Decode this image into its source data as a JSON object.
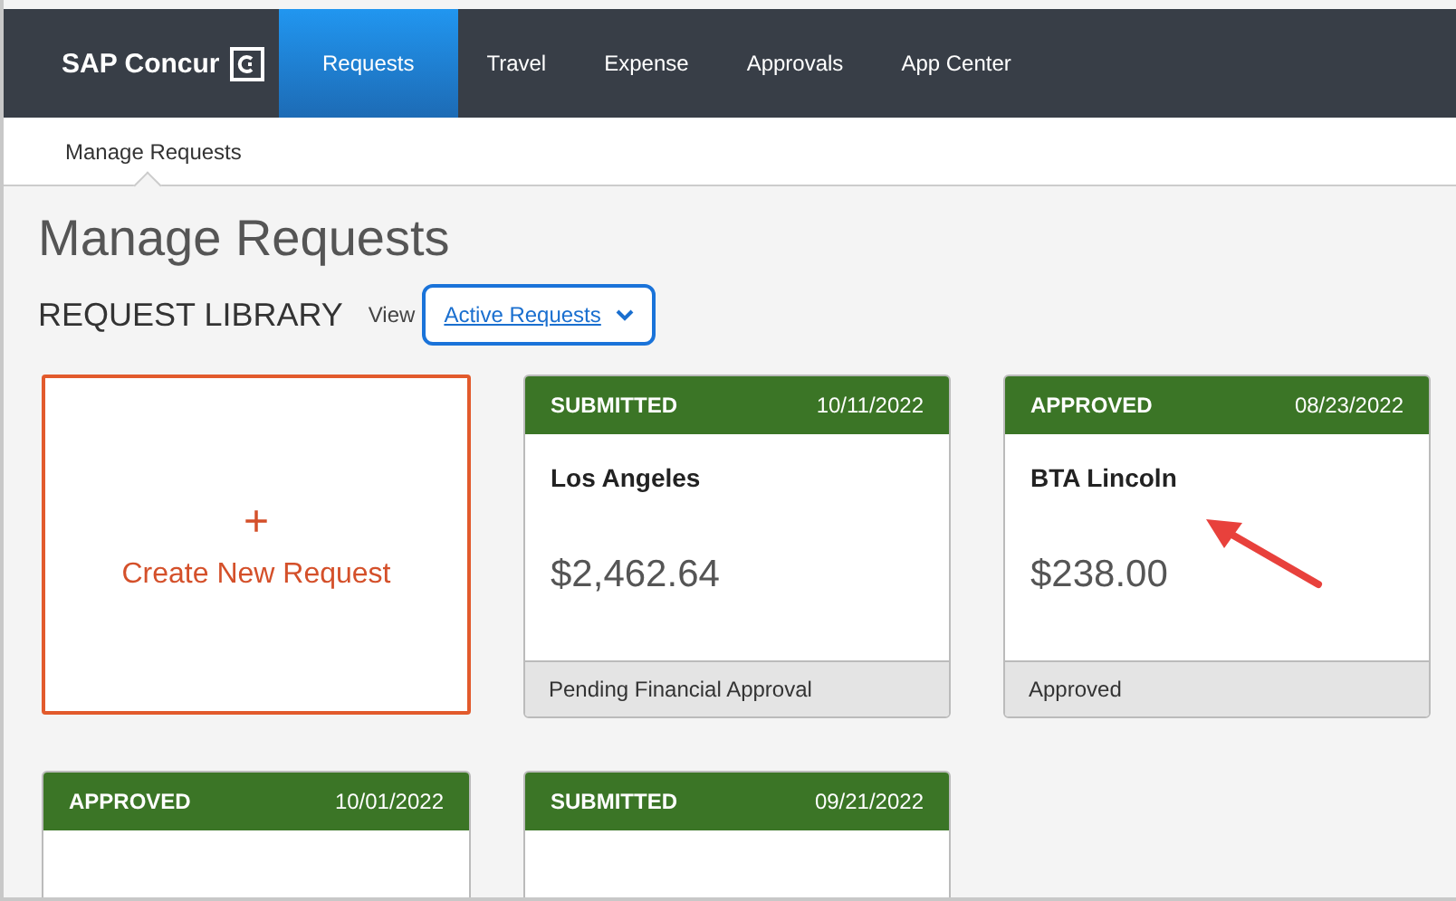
{
  "brand": {
    "name": "SAP Concur"
  },
  "nav": [
    {
      "label": "Requests",
      "selected": true
    },
    {
      "label": "Travel",
      "selected": false
    },
    {
      "label": "Expense",
      "selected": false
    },
    {
      "label": "Approvals",
      "selected": false
    },
    {
      "label": "App Center",
      "selected": false
    }
  ],
  "subnav": [
    {
      "label": "Manage Requests",
      "selected": true
    }
  ],
  "page_title": "Manage Requests",
  "library": {
    "heading": "REQUEST LIBRARY",
    "view_label": "View",
    "view_value": "Active Requests"
  },
  "cards": [
    {
      "kind": "create",
      "icon": "+",
      "label": "Create New Request"
    },
    {
      "kind": "request",
      "status": "SUBMITTED",
      "date": "10/11/2022",
      "title": "Los Angeles",
      "amount": "$2,462.64",
      "footer": "Pending Financial Approval"
    },
    {
      "kind": "request",
      "status": "APPROVED",
      "date": "08/23/2022",
      "title": "BTA Lincoln",
      "amount": "$238.00",
      "footer": "Approved"
    },
    {
      "kind": "request",
      "status": "APPROVED",
      "date": "10/01/2022"
    },
    {
      "kind": "request",
      "status": "SUBMITTED",
      "date": "09/21/2022"
    }
  ]
}
